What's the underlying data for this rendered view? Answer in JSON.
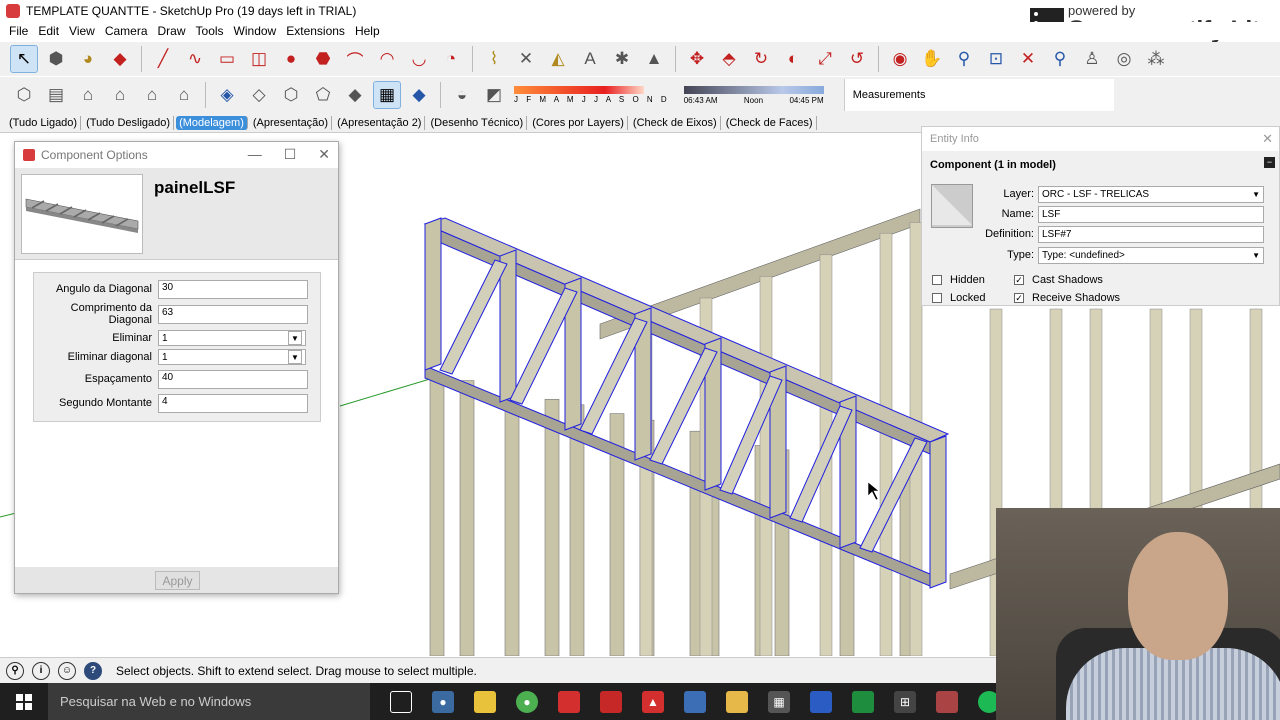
{
  "window": {
    "title": "TEMPLATE QUANTTE - SketchUp Pro (19 days left in TRIAL)"
  },
  "menu": [
    "File",
    "Edit",
    "View",
    "Camera",
    "Draw",
    "Tools",
    "Window",
    "Extensions",
    "Help"
  ],
  "watermark": {
    "small": "powered by",
    "big": "Screencastify Lite"
  },
  "shadow": {
    "months": "J F M A M J J A S O N D",
    "time_start": "06:43 AM",
    "time_mid": "Noon",
    "time_end": "04:45 PM"
  },
  "measurements_label": "Measurements",
  "scenes": [
    "(Tudo Ligado)",
    "(Tudo Desligado)",
    "(Modelagem)",
    "(Apresentação)",
    "(Apresentação 2)",
    "(Desenho Técnico)",
    "(Cores por Layers)",
    "(Check de Eixos)",
    "(Check de Faces)"
  ],
  "active_scene_index": 2,
  "component_options": {
    "title": "Component Options",
    "name": "painelLSF",
    "fields": [
      {
        "label": "Angulo da Diagonal",
        "value": "30",
        "type": "input"
      },
      {
        "label": "Comprimento da Diagonal",
        "value": "63",
        "type": "input"
      },
      {
        "label": "Eliminar",
        "value": "1",
        "type": "select"
      },
      {
        "label": "Eliminar diagonal",
        "value": "1",
        "type": "select"
      },
      {
        "label": "Espaçamento",
        "value": "40",
        "type": "input"
      },
      {
        "label": "Segundo Montante",
        "value": "4",
        "type": "input"
      }
    ],
    "apply_label": "Apply"
  },
  "entity_info": {
    "title": "Entity Info",
    "heading": "Component (1 in model)",
    "layer_label": "Layer:",
    "layer_value": "ORC - LSF - TRELICAS",
    "name_label": "Name:",
    "name_value": "LSF",
    "definition_label": "Definition:",
    "definition_value": "LSF#7",
    "type_label": "Type:",
    "type_value": "Type: <undefined>",
    "hidden_label": "Hidden",
    "hidden_checked": false,
    "locked_label": "Locked",
    "locked_checked": false,
    "cast_label": "Cast Shadows",
    "cast_checked": true,
    "receive_label": "Receive Shadows",
    "receive_checked": true
  },
  "status": {
    "text": "Select objects. Shift to extend select. Drag mouse to select multiple."
  },
  "taskbar": {
    "search_placeholder": "Pesquisar na Web e no Windows"
  },
  "colors": {
    "selection": "#2020e0",
    "active_scene": "#3c8fdb",
    "stud": "#c8c4a8"
  }
}
